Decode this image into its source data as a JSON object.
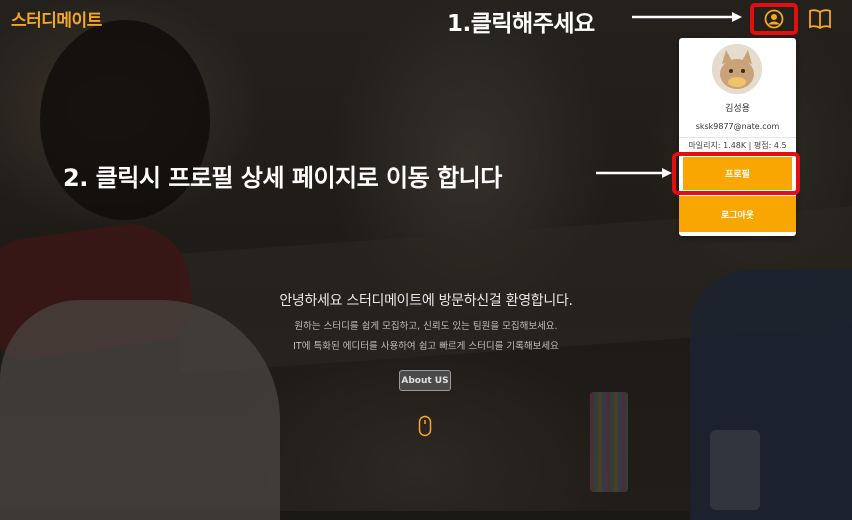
{
  "header": {
    "logo": "스터디메이트",
    "user_icon": "user-circle-icon",
    "book_icon": "book-icon"
  },
  "annotations": {
    "step1": "1.클릭해주세요",
    "step2": "2. 클릭시 프로필 상세 페이지로 이동 합니다"
  },
  "dropdown": {
    "avatar": "avatar-cat-image",
    "username": "김성용",
    "email": "sksk9877@nate.com",
    "stats": "마일리지: 1.48K | 평점: 4.5",
    "profile_button": "프로필",
    "logout_button": "로그아웃"
  },
  "hero": {
    "title": "안녕하세요 스터디메이트에 방문하신걸 환영합니다.",
    "subtitle1": "원하는 스터디를 쉽게 모집하고, 신뢰도 있는 팀원을 모집해보세요.",
    "subtitle2": "IT에 특화된 에디터를 사용하여 쉽고 빠르게 스터디를 기록해보세요",
    "about_button": "About US",
    "scroll_icon": "mouse-scroll-icon"
  },
  "colors": {
    "accent": "#f9a602",
    "highlight": "#e01010",
    "logo": "#f5a623"
  }
}
